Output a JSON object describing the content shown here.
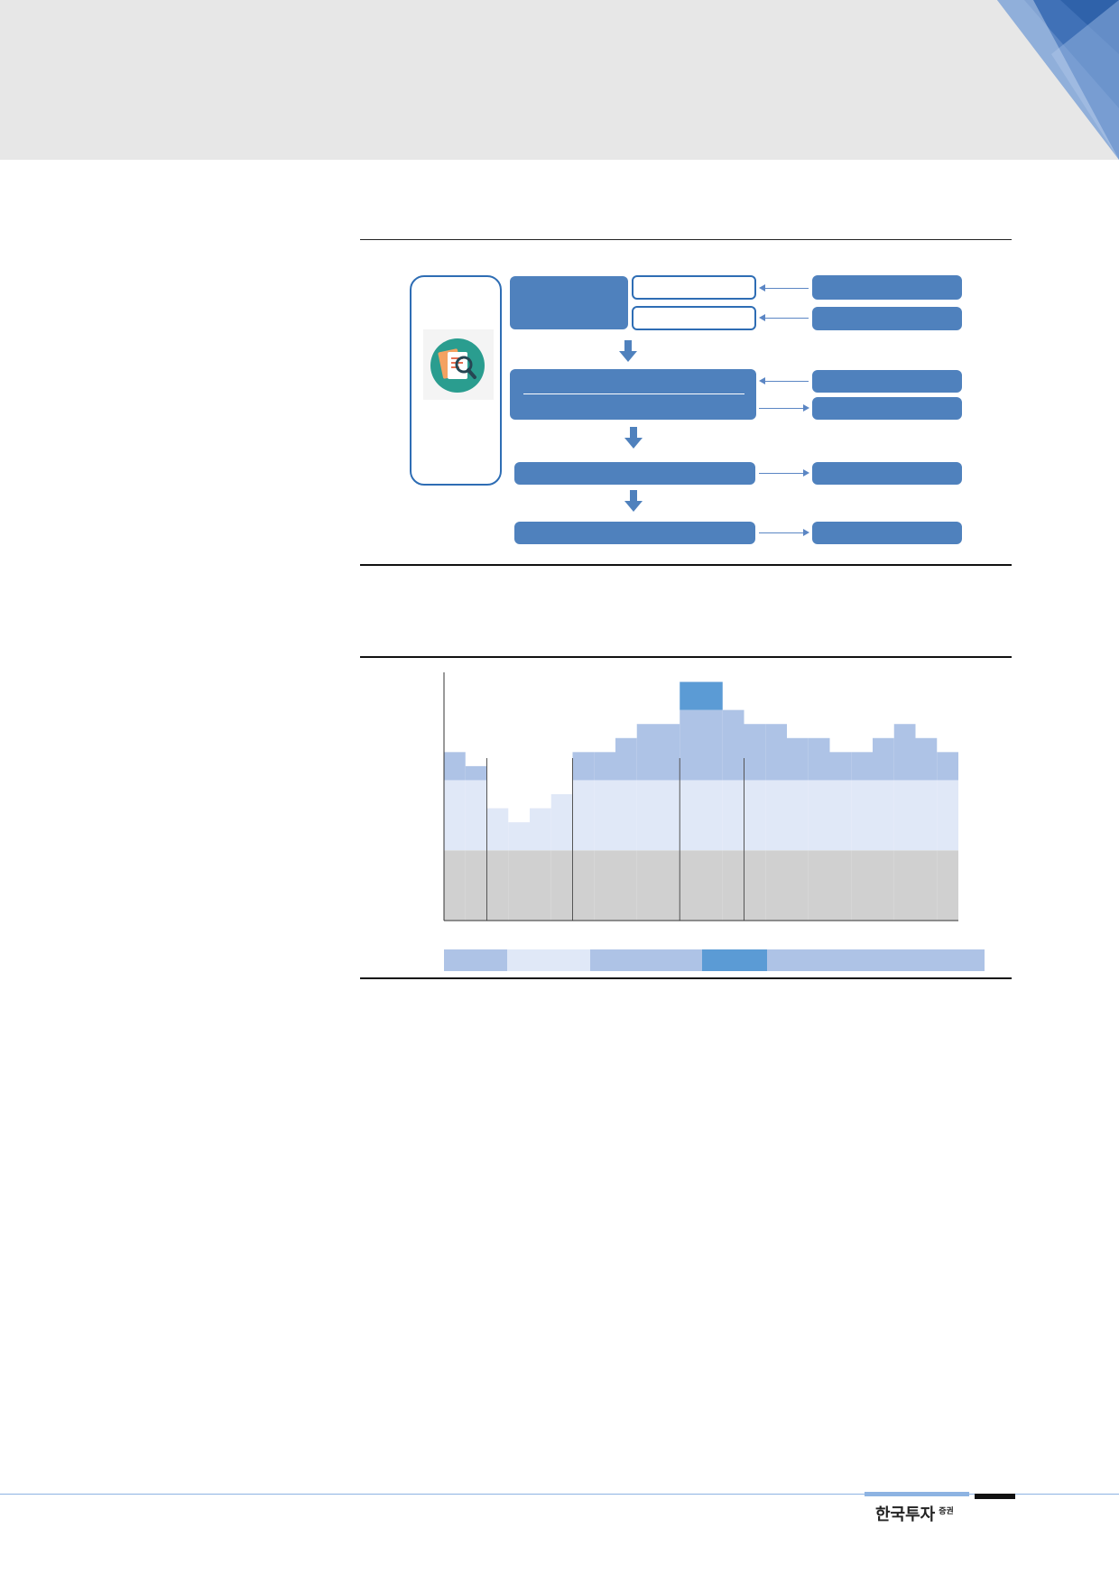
{
  "footer": {
    "brand": "한국투자",
    "brand_suffix": "증권"
  },
  "colors": {
    "header_band": "#e7e7e7",
    "box_blue": "#4f81bd",
    "outline_blue": "#2e6db4",
    "chart_dark": "#5b9bd5",
    "chart_mid": "#aec3e6",
    "chart_light": "#e0e8f7",
    "chart_gray": "#d0d0d0"
  },
  "diagram": {
    "icon": "document-search-icon"
  },
  "chart_data": {
    "type": "area",
    "xlabel": "",
    "ylabel": "",
    "ylim": [
      0,
      18
    ],
    "segments": [
      {
        "band": "mid",
        "columns": [
          [
            12,
            10
          ],
          [
            11,
            10
          ]
        ]
      },
      {
        "band": "light",
        "columns": [
          [
            8,
            5
          ],
          [
            7,
            5
          ],
          [
            8,
            5
          ],
          [
            9,
            5
          ]
        ]
      },
      {
        "band": "mid",
        "columns": [
          [
            12,
            10
          ],
          [
            12,
            10
          ],
          [
            13,
            10
          ],
          [
            14,
            10
          ],
          [
            14,
            10
          ]
        ]
      },
      {
        "band": "dark",
        "columns": [
          [
            17,
            15
          ],
          [
            17,
            15
          ],
          [
            15,
            10
          ]
        ]
      },
      {
        "band": "mid",
        "columns": [
          [
            14,
            10
          ],
          [
            14,
            10
          ],
          [
            13,
            10
          ],
          [
            13,
            10
          ],
          [
            12,
            10
          ],
          [
            12,
            10
          ],
          [
            13,
            10
          ],
          [
            14,
            10
          ],
          [
            13,
            10
          ],
          [
            12,
            10
          ]
        ]
      }
    ],
    "gray_level": 5,
    "light_level": 10,
    "legend_bands": [
      "mid",
      "light",
      "mid",
      "dark",
      "mid"
    ]
  }
}
